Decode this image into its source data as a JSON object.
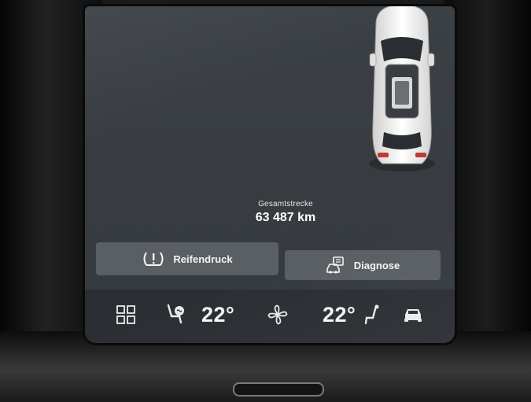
{
  "odometer": {
    "label": "Gesamtstrecke",
    "value": "63 487 km"
  },
  "actions": {
    "tire_pressure_label": "Reifendruck",
    "diagnosis_label": "Diagnose"
  },
  "climate": {
    "driver_temp": "22°",
    "passenger_temp": "22°"
  },
  "icons": {
    "tire_pressure": "tire-pressure-warning-icon",
    "diagnosis": "car-diagnosis-icon",
    "apps": "app-grid-icon",
    "driver_seat_heat": "driver-seat-heat-icon",
    "fan": "fan-icon",
    "passenger_seat": "passenger-seat-icon",
    "car": "car-icon"
  }
}
